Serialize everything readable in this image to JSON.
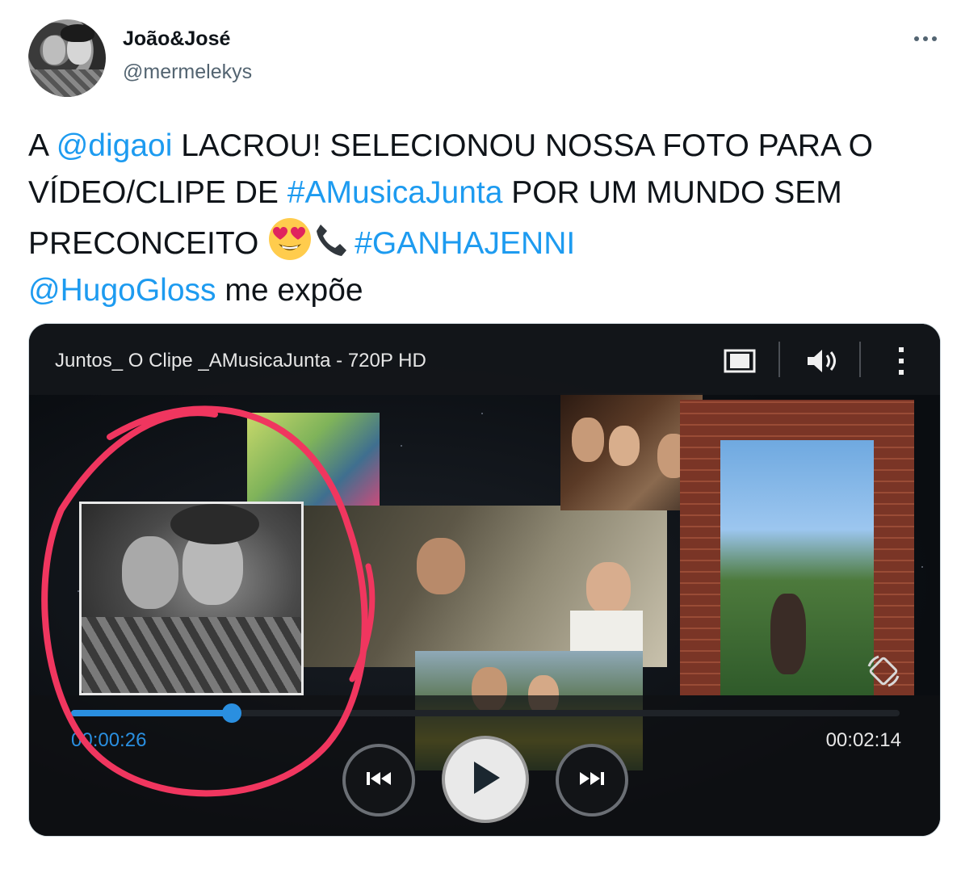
{
  "tweet": {
    "display_name": "João&José",
    "handle": "@mermelekys",
    "text_parts": {
      "p1": "A ",
      "mention1": "@digaoi",
      "p2": " LACROU! SELECIONOU NOSSA FOTO PARA O VÍDEO/CLIPE DE ",
      "hashtag1": "#AMusicaJunta",
      "p3": " POR UM MUNDO SEM PRECONCEITO ",
      "emoji1": "smiling-face-with-heart-eyes",
      "emoji2": "telephone-receiver",
      "hashtag2": "#GANHAJENNI",
      "mention2": "@HugoGloss",
      "p4": " me expõe"
    },
    "more_icon": "more-horizontal-icon",
    "link_color": "#1d9bf0"
  },
  "player": {
    "title": "Juntos_ O Clipe _AMusicaJunta - 720P HD",
    "current_time": "00:00:26",
    "total_time": "00:02:14",
    "progress": 0.194,
    "accent_color": "#2a8fe0",
    "icons": [
      "fullscreen-icon",
      "volume-icon",
      "more-vertical-icon",
      "rewind-icon",
      "play-icon",
      "fast-forward-icon",
      "rotate-icon"
    ],
    "annotation_color": "#f0365f"
  }
}
